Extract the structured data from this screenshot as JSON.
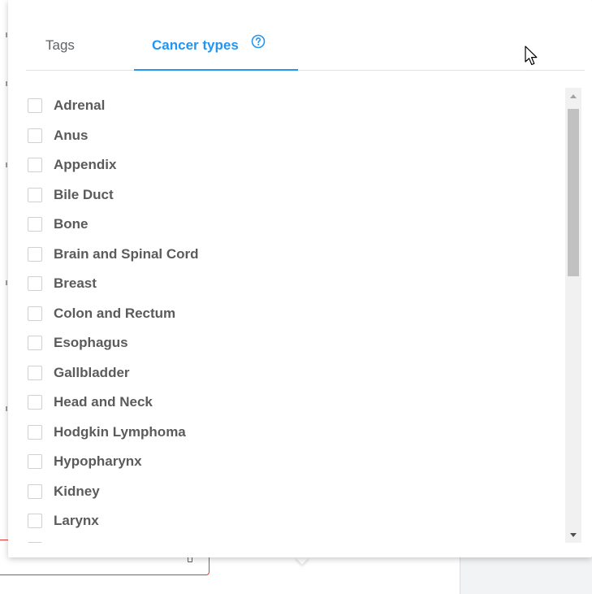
{
  "tabs": [
    {
      "label": "Tags",
      "active": false
    },
    {
      "label": "Cancer types",
      "active": true,
      "icon": "help-circle-icon"
    }
  ],
  "accent_color": "#2196f3",
  "cancer_types": [
    {
      "label": "Adrenal",
      "checked": false
    },
    {
      "label": "Anus",
      "checked": false
    },
    {
      "label": "Appendix",
      "checked": false
    },
    {
      "label": "Bile Duct",
      "checked": false
    },
    {
      "label": "Bone",
      "checked": false
    },
    {
      "label": "Brain and Spinal Cord",
      "checked": false
    },
    {
      "label": "Breast",
      "checked": false
    },
    {
      "label": "Colon and Rectum",
      "checked": false
    },
    {
      "label": "Esophagus",
      "checked": false
    },
    {
      "label": "Gallbladder",
      "checked": false
    },
    {
      "label": "Head and Neck",
      "checked": false
    },
    {
      "label": "Hodgkin Lymphoma",
      "checked": false
    },
    {
      "label": "Hypopharynx",
      "checked": false
    },
    {
      "label": "Kidney",
      "checked": false
    },
    {
      "label": "Larynx",
      "checked": false
    }
  ]
}
